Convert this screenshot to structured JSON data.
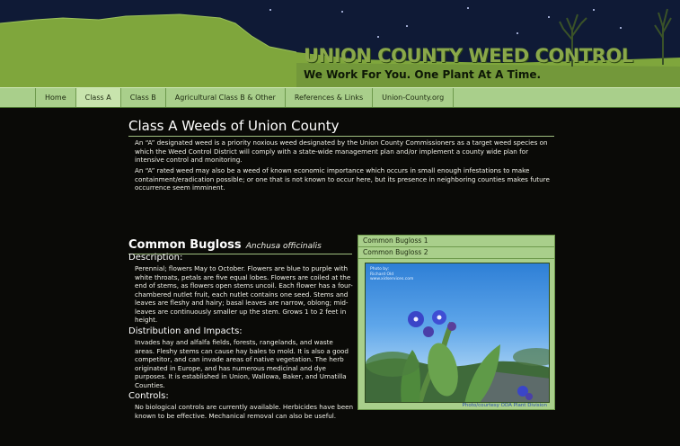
{
  "header": {
    "site_title": "UNION COUNTY WEED CONTROL",
    "tagline": "We Work For You. One Plant At A Time."
  },
  "nav": {
    "items": [
      {
        "label": "Home",
        "active": false
      },
      {
        "label": "Class A",
        "active": true
      },
      {
        "label": "Class B",
        "active": false
      },
      {
        "label": "Agricultural Class B & Other",
        "active": false
      },
      {
        "label": "References & Links",
        "active": false
      },
      {
        "label": "Union-County.org",
        "active": false
      }
    ]
  },
  "main": {
    "title": "Class A Weeds of Union County",
    "intro": [
      "An “A” designated weed is a priority noxious weed designated by the Union County Commissioners as a target weed species on which the Weed Control District will comply with a state-wide management plan and/or implement a county wide plan for intensive control and monitoring.",
      "An “A” rated weed may also be a weed of known economic importance which occurs in small enough infestations to make containment/eradication possible; or one that is not known to occur here, but its presence in neighboring counties makes future occurrence seem imminent."
    ]
  },
  "weed": {
    "common_name": "Common Bugloss",
    "scientific_name": "Anchusa officinalis",
    "description_heading": "Description:",
    "description": "Perennial; flowers May to October. Flowers are blue to purple with white throats, petals are five equal lobes. Flowers are coiled at the end of stems, as flowers open stems uncoil. Each flower has a four-chambered nutlet fruit, each nutlet contains one seed. Stems and leaves are fleshy and hairy; basal leaves are narrow, oblong; mid-leaves are continuously smaller up the stem. Grows 1 to 2 feet in height.",
    "distribution_heading": "Distribution and Impacts:",
    "distribution": "Invades hay and alfalfa fields, forests, rangelands, and waste areas. Fleshy stems can cause hay bales to mold. It is also a good competitor, and can invade areas of native vegetation. The herb originated in Europe, and has numerous medicinal and dye purposes. It is established in Union, Wallowa, Baker, and Umatilla Counties.",
    "controls_heading": "Controls:",
    "controls": "No biological controls are currently available. Herbicides have been known to be effective. Mechanical removal can also be useful."
  },
  "gallery": {
    "tabs": [
      "Common Bugloss 1",
      "Common Bugloss 2"
    ],
    "photo_credit_lines": [
      "Photo by:",
      "Richard Old",
      "www.xidservices.com"
    ],
    "caption": "Photo/courtesy ODA Plant Division"
  },
  "colors": {
    "nav_bg": "#a9cf8b",
    "banner_sky": "#0f1a36",
    "banner_green": "#7fa63c",
    "title_green": "#8aa84a",
    "caption_blue": "#2a4fb0"
  }
}
